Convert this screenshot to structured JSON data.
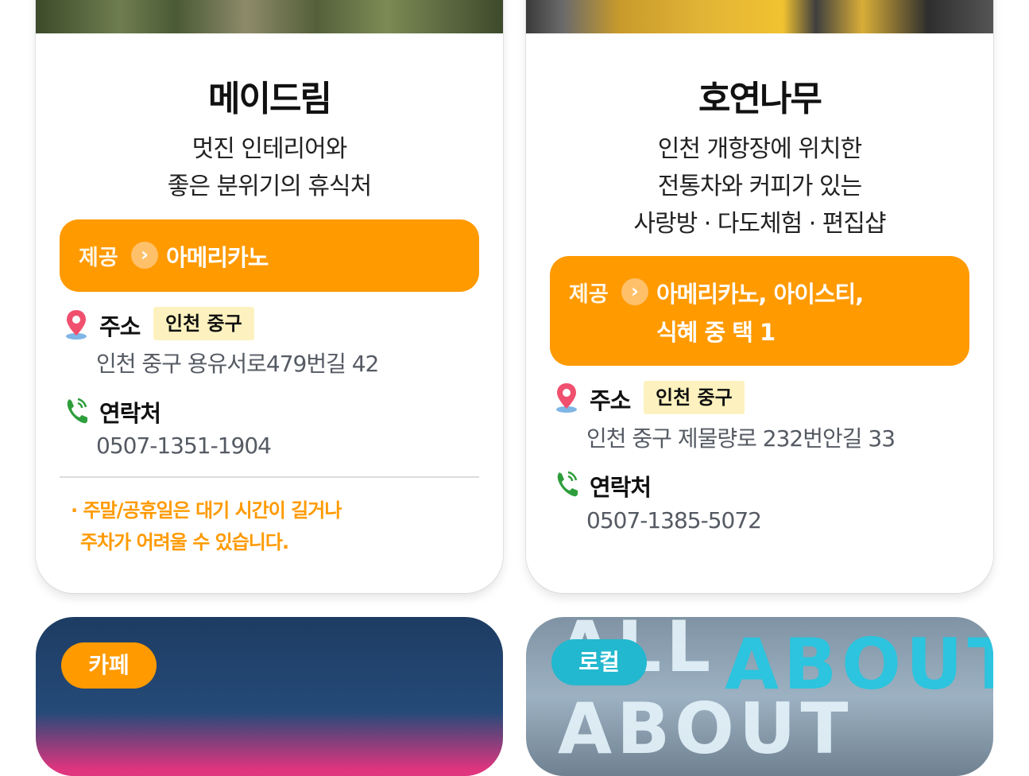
{
  "colors": {
    "accent": "#ff9a00",
    "region_bg": "#fdf2bf",
    "local_tag": "#22b8cf"
  },
  "icons": {
    "offer": "chevron-right-icon",
    "address": "location-pin-icon",
    "contact": "phone-icon"
  },
  "cards": [
    {
      "name": "메이드림",
      "description": [
        "멋진 인테리어와",
        "좋은 분위기의 휴식처"
      ],
      "offer_label": "제공",
      "offer_lines": [
        "아메리카노"
      ],
      "address_label": "주소",
      "region": "인천 중구",
      "address": "인천 중구 용유서로479번길 42",
      "contact_label": "연락처",
      "phone": "0507-1351-1904",
      "notes": [
        "· 주말/공휴일은 대기 시간이 길거나",
        "주차가 어려울 수 있습니다."
      ]
    },
    {
      "name": "호연나무",
      "description": [
        "인천 개항장에 위치한",
        "전통차와 커피가 있는",
        "사랑방 · 다도체험 · 편집샵"
      ],
      "offer_label": "제공",
      "offer_lines": [
        "아메리카노, 아이스티,",
        "식혜 중 택 1"
      ],
      "address_label": "주소",
      "region": "인천 중구",
      "address": "인천 중구 제물량로 232번안길 33",
      "contact_label": "연락처",
      "phone": "0507-1385-5072"
    }
  ],
  "next_cards": [
    {
      "tag": "카페"
    },
    {
      "tag": "로컬",
      "sign_text": "ALL ABOUT",
      "sign_text_2": "ABOUT"
    }
  ]
}
